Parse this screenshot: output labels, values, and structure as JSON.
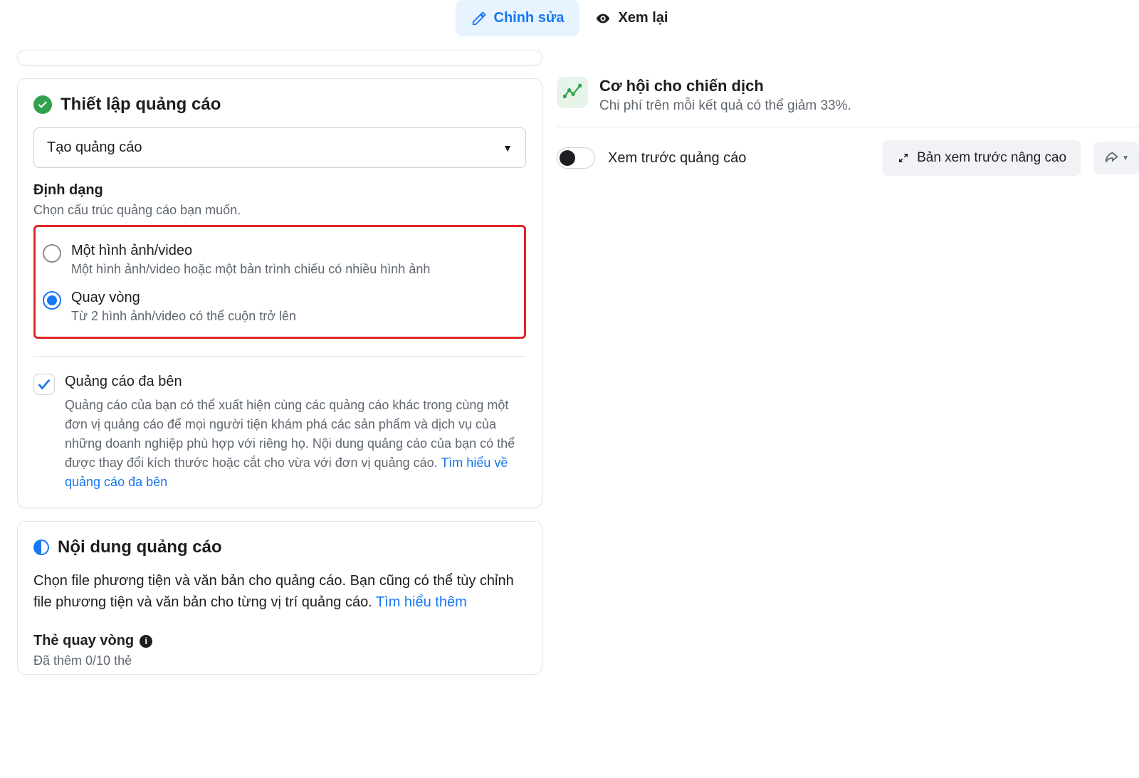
{
  "tabs": {
    "edit": "Chỉnh sửa",
    "review": "Xem lại"
  },
  "setup": {
    "title": "Thiết lập quảng cáo",
    "dropdown": "Tạo quảng cáo",
    "format_label": "Định dạng",
    "format_desc": "Chọn cấu trúc quảng cáo bạn muốn.",
    "options": [
      {
        "title": "Một hình ảnh/video",
        "desc": "Một hình ảnh/video hoặc một bản trình chiếu có nhiều hình ảnh",
        "selected": false
      },
      {
        "title": "Quay vòng",
        "desc": "Từ 2 hình ảnh/video có thể cuộn trở lên",
        "selected": true
      }
    ],
    "multi": {
      "title": "Quảng cáo đa bên",
      "desc": "Quảng cáo của bạn có thể xuất hiện cùng các quảng cáo khác trong cùng một đơn vị quảng cáo để mọi người tiện khám phá các sản phẩm và dịch vụ của những doanh nghiệp phù hợp với riêng họ. Nội dung quảng cáo của bạn có thể được thay đổi kích thước hoặc cắt cho vừa với đơn vị quảng cáo. ",
      "link": "Tìm hiểu về quảng cáo đa bên"
    }
  },
  "content": {
    "title": "Nội dung quảng cáo",
    "body": "Chọn file phương tiện và văn bản cho quảng cáo. Bạn cũng có thể tùy chỉnh file phương tiện và văn bản cho từng vị trí quảng cáo. ",
    "link": "Tìm hiểu thêm",
    "carousel_label": "Thẻ quay vòng",
    "carousel_count": "Đã thêm 0/10 thẻ"
  },
  "opportunity": {
    "title": "Cơ hội cho chiến dịch",
    "desc": "Chi phí trên mỗi kết quả có thể giảm 33%."
  },
  "preview": {
    "label": "Xem trước quảng cáo",
    "advanced": "Bản xem trước nâng cao"
  }
}
